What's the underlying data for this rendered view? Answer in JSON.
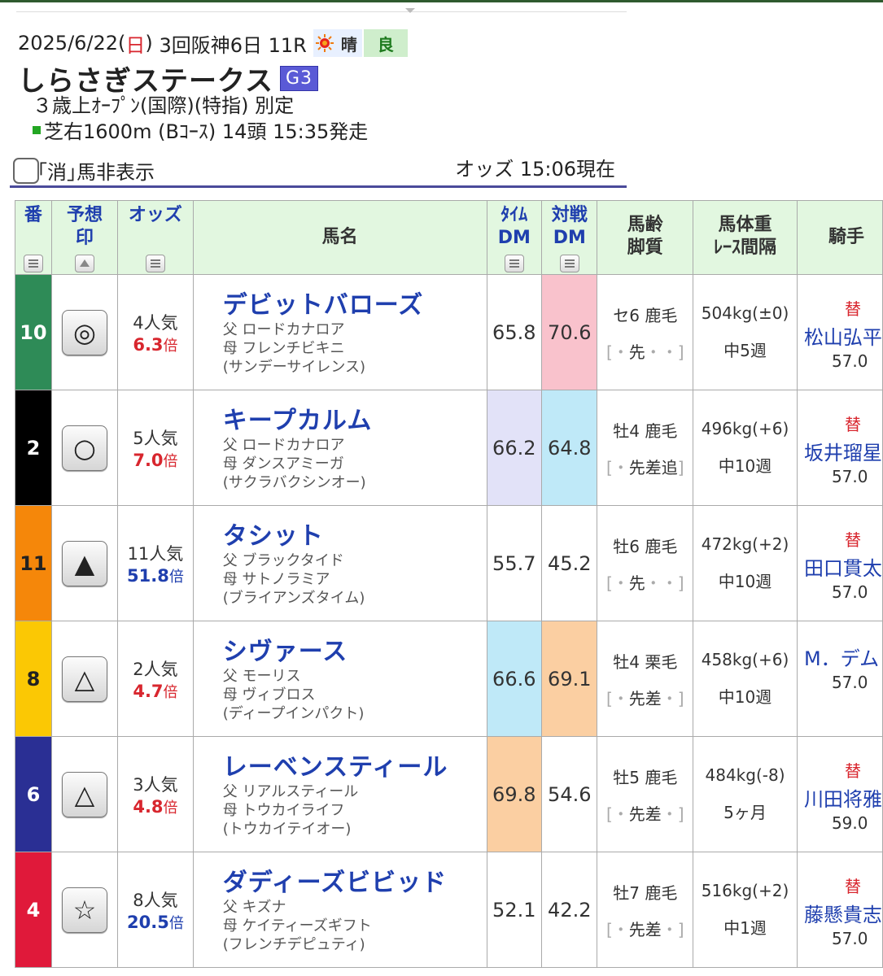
{
  "header": {
    "date": "2025/6/22(",
    "dow": "日",
    "date_close": ")",
    "meeting": "3回阪神6日 11R",
    "weather_icon": "sun-icon",
    "weather": "晴",
    "track_condition": "良"
  },
  "race": {
    "name": "しらさぎステークス",
    "grade": "G3",
    "conditions": "３歳上ｵｰﾌﾟﾝ(国際)(特指) 別定",
    "course": "芝右1600m (Bｺｰｽ) 14頭 15:35発走"
  },
  "toolbar": {
    "hide_label": "｢消｣馬非表示",
    "odds_time": "オッズ 15:06現在"
  },
  "columns": {
    "num": "番",
    "mark_1": "予想",
    "mark_2": "印",
    "odds": "オッズ",
    "horse": "馬名",
    "time_dm_1": "ﾀｲﾑ",
    "time_dm_2": "DM",
    "vs_dm_1": "対戦",
    "vs_dm_2": "DM",
    "age_1": "馬齢",
    "age_2": "脚質",
    "weight_1": "馬体重",
    "weight_2": "ﾚｰｽ間隔",
    "jockey": "騎手"
  },
  "colors": {
    "frame_green": "#2e8b57",
    "frame_black": "#000000",
    "frame_orange": "#f5870a",
    "frame_yellow": "#fbc804",
    "frame_blue": "#2a2f94",
    "frame_red": "#e0193a",
    "dm_pink": "#f9c2cc",
    "dm_lavender": "#e2e2f8",
    "dm_cyan": "#bfe9f8",
    "dm_peach": "#fbcfa2"
  },
  "rows": [
    {
      "num": "10",
      "mark": "◎",
      "pop": "4人気",
      "odds": "6.3",
      "bai": "倍",
      "odds_color": "red",
      "name": "デビットバローズ",
      "sire": "父 ロードカナロア",
      "dam": "母 フレンチビキニ",
      "damsire": "(サンデーサイレンス)",
      "time_dm": "65.8",
      "vs_dm": "70.6",
      "age": "セ6 鹿毛",
      "style_pre": "[・",
      "style_mid": "先",
      "style_post": "・・]",
      "weight": "504kg(±0)",
      "interval": "中5週",
      "jockey_change": "替",
      "jockey": "松山弘平",
      "jockey_weight": "57.0"
    },
    {
      "num": "2",
      "mark": "○",
      "pop": "5人気",
      "odds": "7.0",
      "bai": "倍",
      "odds_color": "red",
      "name": "キープカルム",
      "sire": "父 ロードカナロア",
      "dam": "母 ダンスアミーガ",
      "damsire": "(サクラバクシンオー)",
      "time_dm": "66.2",
      "vs_dm": "64.8",
      "age": "牡4 鹿毛",
      "style_pre": "[・",
      "style_mid": "先差追",
      "style_post": "]",
      "weight": "496kg(+6)",
      "interval": "中10週",
      "jockey_change": "替",
      "jockey": "坂井瑠星",
      "jockey_weight": "57.0"
    },
    {
      "num": "11",
      "mark": "▲",
      "pop": "11人気",
      "odds": "51.8",
      "bai": "倍",
      "odds_color": "blue",
      "name": "タシット",
      "sire": "父 ブラックタイド",
      "dam": "母 サトノラミア",
      "damsire": "(ブライアンズタイム)",
      "time_dm": "55.7",
      "vs_dm": "45.2",
      "age": "牡6 鹿毛",
      "style_pre": "[・",
      "style_mid": "先",
      "style_post": "・・]",
      "weight": "472kg(+2)",
      "interval": "中10週",
      "jockey_change": "替",
      "jockey": "田口貫太",
      "jockey_weight": "57.0"
    },
    {
      "num": "8",
      "mark": "△",
      "pop": "2人気",
      "odds": "4.7",
      "bai": "倍",
      "odds_color": "red",
      "name": "シヴァース",
      "sire": "父 モーリス",
      "dam": "母 ヴィブロス",
      "damsire": "(ディープインパクト)",
      "time_dm": "66.6",
      "vs_dm": "69.1",
      "age": "牡4 栗毛",
      "style_pre": "[・",
      "style_mid": "先差",
      "style_post": "・]",
      "weight": "458kg(+6)",
      "interval": "中10週",
      "jockey_change": "",
      "jockey": "M．デム",
      "jockey_weight": "57.0"
    },
    {
      "num": "6",
      "mark": "△",
      "pop": "3人気",
      "odds": "4.8",
      "bai": "倍",
      "odds_color": "red",
      "name": "レーベンスティール",
      "sire": "父 リアルスティール",
      "dam": "母 トウカイライフ",
      "damsire": "(トウカイテイオー)",
      "time_dm": "69.8",
      "vs_dm": "54.6",
      "age": "牡5 鹿毛",
      "style_pre": "[・",
      "style_mid": "先差",
      "style_post": "・]",
      "weight": "484kg(-8)",
      "interval": "5ヶ月",
      "jockey_change": "替",
      "jockey": "川田将雅",
      "jockey_weight": "59.0"
    },
    {
      "num": "4",
      "mark": "☆",
      "pop": "8人気",
      "odds": "20.5",
      "bai": "倍",
      "odds_color": "blue",
      "name": "ダディーズビビッド",
      "sire": "父 キズナ",
      "dam": "母 ケイティーズギフト",
      "damsire": "(フレンチデピュティ)",
      "time_dm": "52.1",
      "vs_dm": "42.2",
      "age": "牡7 鹿毛",
      "style_pre": "[・",
      "style_mid": "先差",
      "style_post": "・]",
      "weight": "516kg(+2)",
      "interval": "中1週",
      "jockey_change": "替",
      "jockey": "藤懸貴志",
      "jockey_weight": "57.0"
    }
  ]
}
